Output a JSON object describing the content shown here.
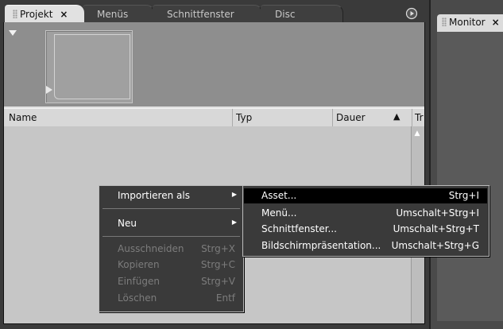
{
  "tabs": [
    {
      "label": "Projekt",
      "close": "×"
    },
    {
      "label": "Menüs"
    },
    {
      "label": "Schnittfenster"
    },
    {
      "label": "Disc"
    }
  ],
  "monitor_tab": {
    "label": "Monitor",
    "close": "×"
  },
  "columns": [
    "Name",
    "Typ",
    "Dauer",
    "Tr"
  ],
  "sort_indicator": "▲",
  "context_menu": {
    "items": [
      {
        "label": "Importieren als",
        "shortcut": "",
        "enabled": true,
        "submenu": true
      },
      {
        "label": "Neu",
        "shortcut": "",
        "enabled": true,
        "submenu": true
      },
      {
        "label": "Ausschneiden",
        "shortcut": "Strg+X",
        "enabled": false
      },
      {
        "label": "Kopieren",
        "shortcut": "Strg+C",
        "enabled": false
      },
      {
        "label": "Einfügen",
        "shortcut": "Strg+V",
        "enabled": false
      },
      {
        "label": "Löschen",
        "shortcut": "Entf",
        "enabled": false
      }
    ]
  },
  "submenu": {
    "items": [
      {
        "label": "Asset...",
        "shortcut": "Strg+I",
        "selected": true
      },
      {
        "label": "Menü...",
        "shortcut": "Umschalt+Strg+I"
      },
      {
        "label": "Schnittfenster...",
        "shortcut": "Umschalt+Strg+T"
      },
      {
        "label": "Bildschirmpräsentation...",
        "shortcut": "Umschalt+Strg+G"
      }
    ]
  },
  "icons": [
    "grip-icon",
    "close-icon",
    "panel-menu-icon",
    "collapse-triangle-icon",
    "play-icon",
    "scroll-up-icon",
    "submenu-arrow-icon"
  ]
}
